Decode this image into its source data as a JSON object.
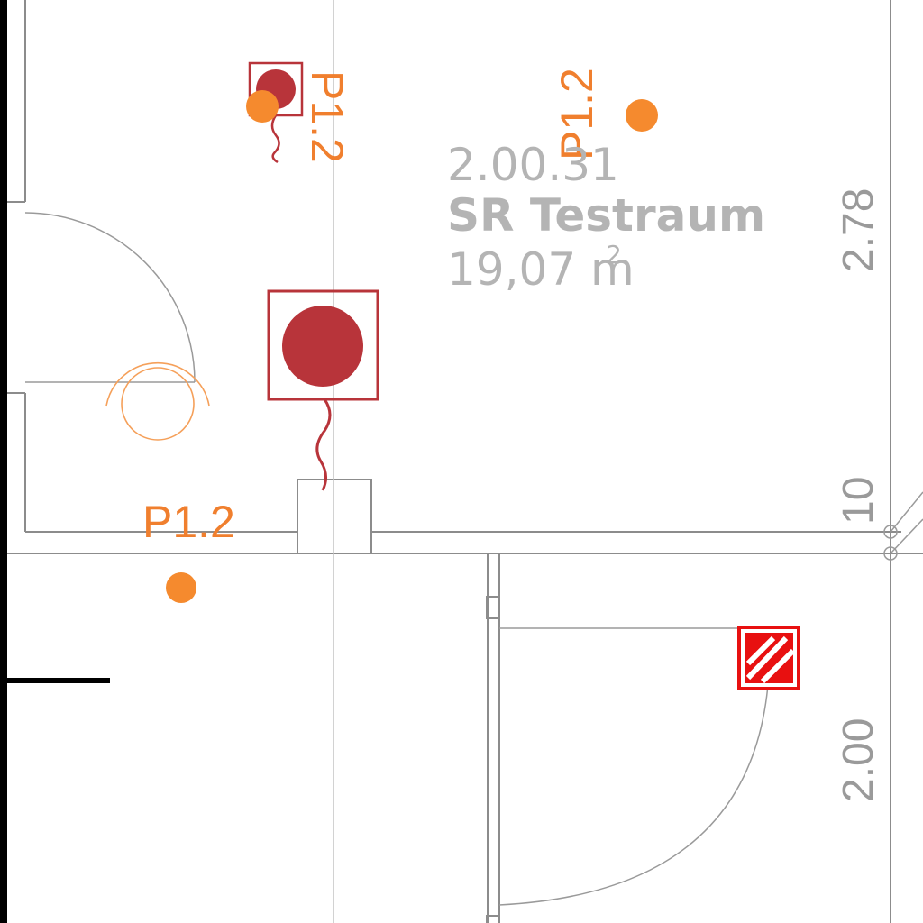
{
  "room": {
    "number": "2.00.31",
    "name": "SR Testraum",
    "area_value": "19,07 m",
    "area_exp": "2"
  },
  "dimensions": {
    "right_upper": "2.78",
    "right_mid": "10",
    "right_lower": "2.00"
  },
  "tags": {
    "tag_top_left": "P1.2",
    "tag_top_right": "P1.2",
    "tag_bottom_left": "P1.2"
  },
  "colors": {
    "wall": "#8c8c8c",
    "room_text": "#b4b4b4",
    "tag": "#f07f2e",
    "fixture": "#b8343a",
    "fire_symbol": "#e81010",
    "hatch_wall": "#000000"
  },
  "icons": {
    "ceiling_outlet_large": "ceiling-light-outlet-icon",
    "ceiling_outlet_small": "ceiling-light-outlet-icon",
    "detector": "smoke-detector-icon",
    "fire_extinguisher": "fire-extinguisher-icon",
    "motion_sensor": "motion-sensor-icon"
  }
}
